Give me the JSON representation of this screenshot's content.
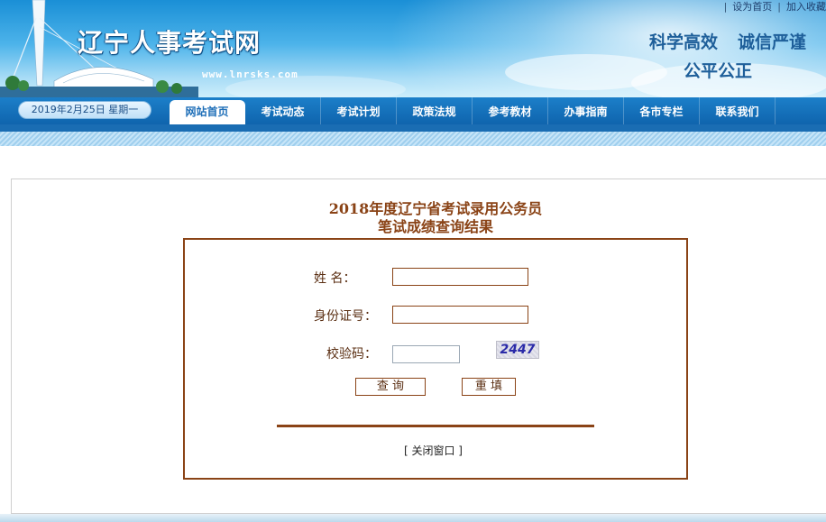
{
  "header": {
    "top_links": [
      "设为首页",
      "加入收藏"
    ],
    "site_title": "辽宁人事考试网",
    "site_url": "www.lnrsks.com",
    "slogans": [
      "科学高效",
      "诚信严谨",
      "公平公正"
    ]
  },
  "nav": {
    "date": "2019年2月25日  星期一",
    "items": [
      {
        "label": "网站首页",
        "active": true
      },
      {
        "label": "考试动态",
        "active": false
      },
      {
        "label": "考试计划",
        "active": false
      },
      {
        "label": "政策法规",
        "active": false
      },
      {
        "label": "参考教材",
        "active": false
      },
      {
        "label": "办事指南",
        "active": false
      },
      {
        "label": "各市专栏",
        "active": false
      },
      {
        "label": "联系我们",
        "active": false
      }
    ]
  },
  "main": {
    "title_line1": "2018年度辽宁省考试录用公务员",
    "title_line2": "笔试成绩查询结果",
    "form": {
      "name_label": "姓    名：",
      "name_value": "",
      "id_label": "身份证号：",
      "id_value": "",
      "code_label": "校验码：",
      "code_value": "",
      "captcha": "2447",
      "query_button": "查  询",
      "reset_button": "重 填"
    },
    "close_link": "[ 关闭窗口 ]"
  },
  "colors": {
    "accent_brown": "#8a4316",
    "nav_blue": "#1c7fc9",
    "title_blue": "#1e5f9a"
  }
}
